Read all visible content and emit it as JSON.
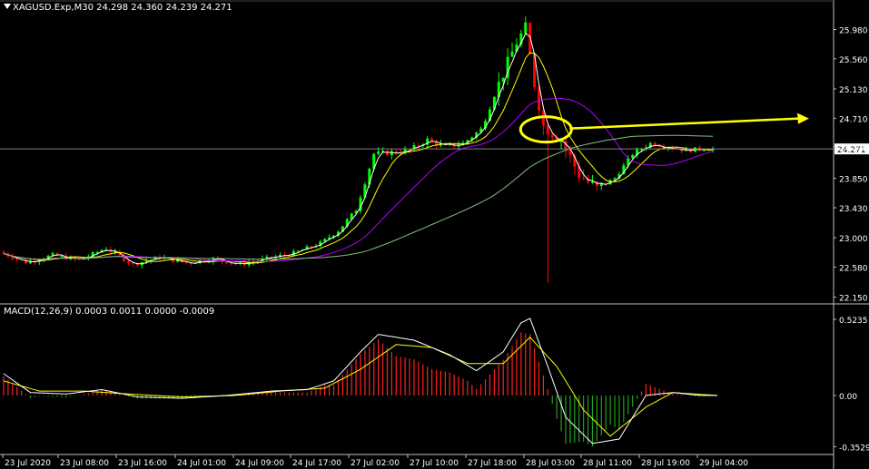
{
  "window": {
    "symbol_header": "XAGUSD.Exp,M30  24.298 24.360 24.239 24.271",
    "current_price_label": "24.271"
  },
  "indicator": {
    "header": "MACD(12,26,9) 0.0003 0.0011 0.0000 -0.0009"
  },
  "colors": {
    "background": "#000000",
    "bull": "#00ff00",
    "bear": "#ff0000",
    "ma_fast": "#ffffff",
    "ma_mid": "#ffff00",
    "ma_slow": "#b000ff",
    "ma_long": "#80c080",
    "annotation": "#ffff00",
    "axis": "#c0c0c0",
    "macd_pos": "#ff2020",
    "macd_neg": "#20a020"
  },
  "icons": [
    "triangle-down-icon"
  ],
  "chart_data": [
    {
      "type": "candlestick",
      "symbol": "XAGUSD.Exp",
      "timeframe": "M30",
      "y_ticks": [
        "25.980",
        "25.560",
        "25.130",
        "24.710",
        "24.290",
        "23.850",
        "23.430",
        "23.000",
        "22.580",
        "22.150"
      ],
      "ylim": [
        22.08,
        26.22
      ],
      "current_price": 24.271,
      "x_ticks": [
        "23 Jul 2020",
        "23 Jul 08:00",
        "23 Jul 16:00",
        "24 Jul 01:00",
        "24 Jul 09:00",
        "24 Jul 17:00",
        "27 Jul 02:00",
        "27 Jul 10:00",
        "27 Jul 18:00",
        "28 Jul 03:00",
        "28 Jul 11:00",
        "28 Jul 19:00",
        "29 Jul 04:00"
      ],
      "bars": 160,
      "price_path": [
        [
          0,
          22.8
        ],
        [
          6,
          22.65
        ],
        [
          12,
          22.75
        ],
        [
          18,
          22.68
        ],
        [
          24,
          22.85
        ],
        [
          30,
          22.62
        ],
        [
          36,
          22.72
        ],
        [
          42,
          22.64
        ],
        [
          48,
          22.7
        ],
        [
          54,
          22.62
        ],
        [
          60,
          22.7
        ],
        [
          66,
          22.78
        ],
        [
          72,
          22.92
        ],
        [
          76,
          23.1
        ],
        [
          80,
          23.4
        ],
        [
          84,
          24.2
        ],
        [
          88,
          24.22
        ],
        [
          92,
          24.25
        ],
        [
          96,
          24.4
        ],
        [
          100,
          24.3
        ],
        [
          104,
          24.35
        ],
        [
          108,
          24.55
        ],
        [
          112,
          25.2
        ],
        [
          116,
          25.8
        ],
        [
          118,
          26.0
        ],
        [
          120,
          25.2
        ],
        [
          122,
          24.6
        ],
        [
          126,
          24.4
        ],
        [
          130,
          23.9
        ],
        [
          134,
          23.7
        ],
        [
          138,
          23.85
        ],
        [
          142,
          24.2
        ],
        [
          146,
          24.35
        ],
        [
          150,
          24.3
        ],
        [
          154,
          24.25
        ],
        [
          158,
          24.28
        ],
        [
          160,
          24.27
        ]
      ],
      "extremes": {
        "high": 26.02,
        "low": 22.35
      },
      "moving_averages": [
        "fast",
        "mid",
        "slow",
        "long"
      ],
      "annotation": {
        "type": "ellipse-and-arrow",
        "level": 24.55
      }
    },
    {
      "type": "macd",
      "params": [
        12,
        26,
        9
      ],
      "y_ticks": [
        "0.5235",
        "0.00",
        "-0.3529"
      ],
      "ylim": [
        -0.4,
        0.58
      ],
      "main_path": [
        [
          0,
          0.15
        ],
        [
          6,
          0.02
        ],
        [
          14,
          0.01
        ],
        [
          22,
          0.04
        ],
        [
          30,
          -0.01
        ],
        [
          40,
          -0.02
        ],
        [
          50,
          0.0
        ],
        [
          60,
          0.03
        ],
        [
          68,
          0.04
        ],
        [
          74,
          0.1
        ],
        [
          80,
          0.3
        ],
        [
          84,
          0.42
        ],
        [
          92,
          0.38
        ],
        [
          100,
          0.28
        ],
        [
          106,
          0.17
        ],
        [
          112,
          0.3
        ],
        [
          116,
          0.5
        ],
        [
          118,
          0.53
        ],
        [
          122,
          0.2
        ],
        [
          126,
          -0.15
        ],
        [
          132,
          -0.33
        ],
        [
          138,
          -0.3
        ],
        [
          144,
          0.0
        ],
        [
          150,
          0.02
        ],
        [
          156,
          0.0
        ],
        [
          160,
          0.0
        ]
      ],
      "signal_path": [
        [
          0,
          0.1
        ],
        [
          8,
          0.03
        ],
        [
          18,
          0.03
        ],
        [
          28,
          0.01
        ],
        [
          40,
          -0.01
        ],
        [
          52,
          0.0
        ],
        [
          62,
          0.03
        ],
        [
          72,
          0.05
        ],
        [
          80,
          0.18
        ],
        [
          88,
          0.35
        ],
        [
          96,
          0.33
        ],
        [
          104,
          0.22
        ],
        [
          112,
          0.22
        ],
        [
          118,
          0.4
        ],
        [
          124,
          0.2
        ],
        [
          130,
          -0.1
        ],
        [
          136,
          -0.28
        ],
        [
          144,
          -0.08
        ],
        [
          150,
          0.02
        ],
        [
          160,
          0.0
        ]
      ]
    }
  ]
}
